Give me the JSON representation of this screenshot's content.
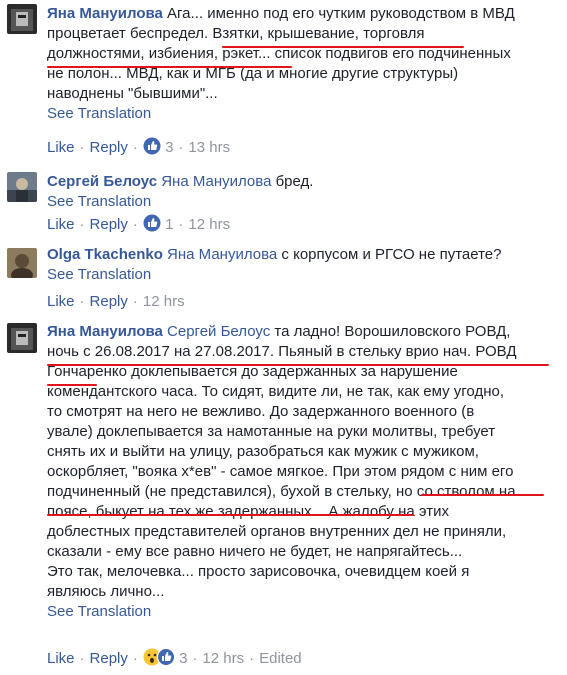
{
  "comments": [
    {
      "author": "Яна Мануилова",
      "tag": "",
      "lines": [
        "Ага... именно под его чутким руководством в МВД",
        "процветает беспредел. Взятки, крышевание, торговля",
        "должностями, избиения, рэкет... список подвигов его подчиненных",
        "не полон... МВД, как и МГБ (да и многие другие структуры)",
        "наводнены \"бывшими\"..."
      ],
      "see_translation": "See Translation",
      "like": "Like",
      "reply": "Reply",
      "reaction_count": "3",
      "time": "13 hrs",
      "edited": ""
    },
    {
      "author": "Сергей Белоус",
      "tag": "Яна Мануилова",
      "lines": [
        "бред."
      ],
      "see_translation": "See Translation",
      "like": "Like",
      "reply": "Reply",
      "reaction_count": "1",
      "time": "12 hrs",
      "edited": ""
    },
    {
      "author": "Olga Tkachenko",
      "tag": "Яна Мануилова",
      "lines": [
        "с корпусом и РГСО не путаете?"
      ],
      "see_translation": "See Translation",
      "like": "Like",
      "reply": "Reply",
      "reaction_count": "",
      "time": "12 hrs",
      "edited": ""
    },
    {
      "author": "Яна Мануилова",
      "tag": "Сергей Белоус",
      "lines": [
        "та ладно! Ворошиловского РОВД,",
        "ночь с 26.08.2017 на 27.08.2017. Пьяный в стельку врио нач. РОВД",
        "Гончаренко доклепывается до задержанных за нарушение",
        "комендантского часа. То сидят, видите ли, не так, как ему угодно,",
        "то смотрят на него не вежливо. До задержанного военного (в",
        "увале) доклепывается за намотанные на руки молитвы, требует",
        "снять их и выйти на улицу, разобраться как мужик с мужиком,",
        "оскорбляет, \"вояка х*ев\" - самое мягкое. При этом рядом с ним его",
        "подчиненный (не представился), бухой в стельку, но со стволом на",
        "поясе, быкует на тех же задержанных... А жалобу на этих",
        "доблестных представителей органов внутренних дел не приняли,",
        "сказали - ему все равно ничего не будет, не напрягайтесь...",
        "Это так, мелочевка... просто зарисовочка, очевидцем коей я",
        "являюсь лично..."
      ],
      "see_translation": "See Translation",
      "like": "Like",
      "reply": "Reply",
      "reaction_count": "3",
      "time": "12 hrs",
      "edited": "Edited"
    }
  ],
  "colors": {
    "link": "#365899",
    "text": "#1d2129",
    "meta": "#90949c",
    "underline": "#e0141a",
    "like_blue": "#4267b2",
    "wow_yellow": "#f7c634"
  },
  "icons": [
    "like-reaction-icon",
    "wow-reaction-icon"
  ]
}
